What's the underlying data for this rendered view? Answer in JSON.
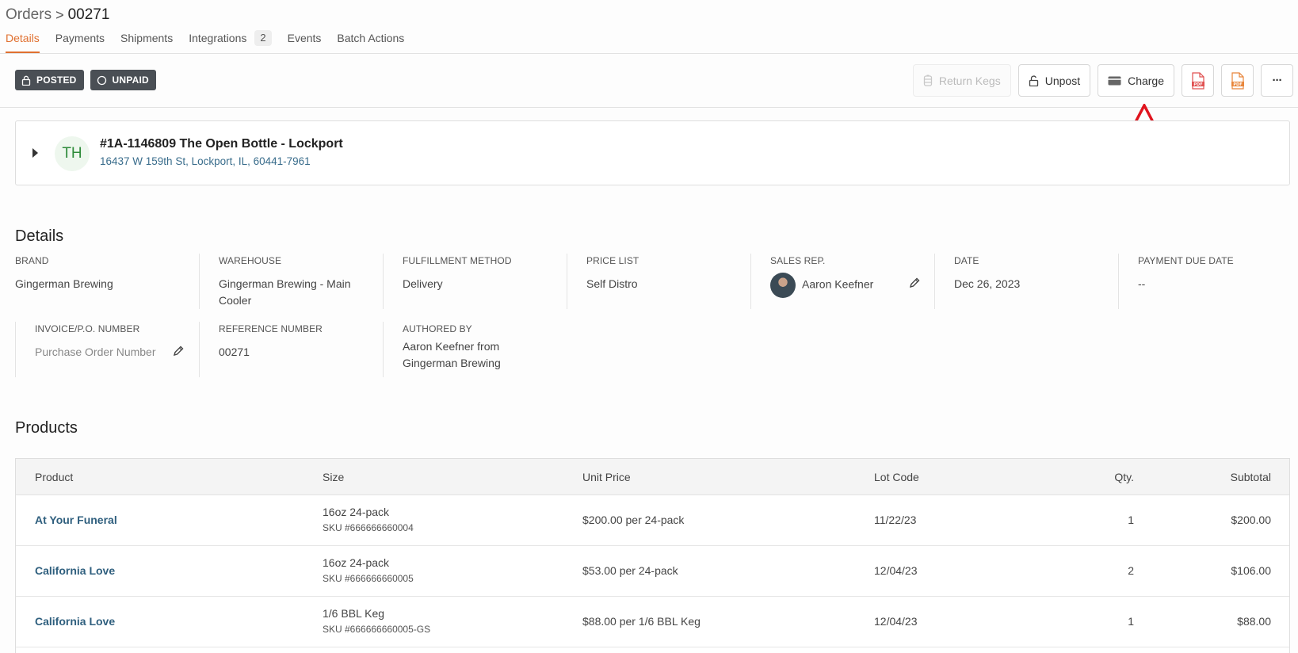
{
  "breadcrumb": {
    "parent": "Orders",
    "separator": ">",
    "current": "00271"
  },
  "tabs": [
    {
      "label": "Details",
      "active": true
    },
    {
      "label": "Payments"
    },
    {
      "label": "Shipments"
    },
    {
      "label": "Integrations",
      "badge": "2"
    },
    {
      "label": "Events"
    },
    {
      "label": "Batch Actions"
    }
  ],
  "status": {
    "posted": "POSTED",
    "unpaid": "UNPAID"
  },
  "actions": {
    "return_kegs": "Return Kegs",
    "unpost": "Unpost",
    "charge": "Charge",
    "pdf1_icon": "pdf-red-icon",
    "pdf2_icon": "pdf-orange-icon",
    "more": "···"
  },
  "customer": {
    "initials": "TH",
    "name": "#1A-1146809 The Open Bottle - Lockport",
    "address": "16437 W 159th St, Lockport, IL, 60441-7961"
  },
  "details": {
    "title": "Details",
    "brand": {
      "label": "BRAND",
      "value": "Gingerman Brewing"
    },
    "warehouse": {
      "label": "WAREHOUSE",
      "value": "Gingerman Brewing - Main Cooler"
    },
    "fulfillment": {
      "label": "FULFILLMENT METHOD",
      "value": "Delivery"
    },
    "price_list": {
      "label": "PRICE LIST",
      "value": "Self Distro"
    },
    "sales_rep": {
      "label": "SALES REP.",
      "value": "Aaron Keefner"
    },
    "date": {
      "label": "DATE",
      "value": "Dec 26, 2023"
    },
    "payment_due": {
      "label": "PAYMENT DUE DATE",
      "value": "--"
    },
    "invoice": {
      "label": "INVOICE/P.O. NUMBER",
      "placeholder": "Purchase Order Number"
    },
    "reference": {
      "label": "REFERENCE NUMBER",
      "value": "00271"
    },
    "authored_by": {
      "label": "AUTHORED BY",
      "value": "Aaron Keefner from Gingerman Brewing"
    }
  },
  "products": {
    "title": "Products",
    "columns": {
      "product": "Product",
      "size": "Size",
      "unit_price": "Unit Price",
      "lot_code": "Lot Code",
      "qty": "Qty.",
      "subtotal": "Subtotal"
    },
    "rows": [
      {
        "product": "At Your Funeral",
        "size": "16oz 24-pack",
        "sku": "SKU #666666660004",
        "unit_price": "$200.00 per 24-pack",
        "lot_code": "11/22/23",
        "qty": "1",
        "subtotal": "$200.00"
      },
      {
        "product": "California Love",
        "size": "16oz 24-pack",
        "sku": "SKU #666666660005",
        "unit_price": "$53.00 per 24-pack",
        "lot_code": "12/04/23",
        "qty": "2",
        "subtotal": "$106.00"
      },
      {
        "product": "California Love",
        "size": "1/6 BBL Keg",
        "sku": "SKU #666666660005-GS",
        "unit_price": "$88.00 per 1/6 BBL Keg",
        "lot_code": "12/04/23",
        "qty": "1",
        "subtotal": "$88.00"
      }
    ]
  },
  "colors": {
    "accent": "#e07030",
    "link": "#2f5f7e",
    "badge_bg": "#4a4f55",
    "annotation": "#e0141e"
  }
}
